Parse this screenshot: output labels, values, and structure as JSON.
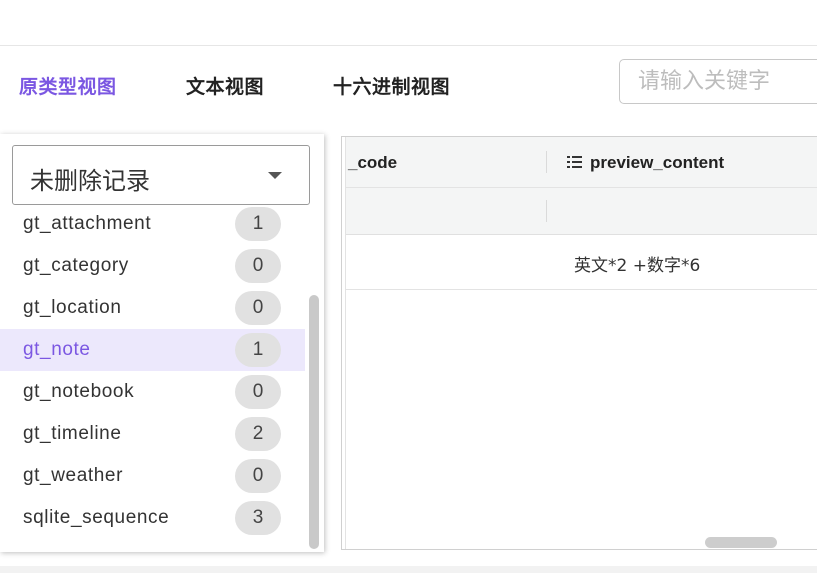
{
  "tabs": [
    {
      "label": "原类型视图",
      "active": true
    },
    {
      "label": "文本视图",
      "active": false
    },
    {
      "label": "十六进制视图",
      "active": false
    }
  ],
  "search": {
    "placeholder": "请输入关键字",
    "value": ""
  },
  "filter_select": {
    "selected": "未删除记录"
  },
  "tables": [
    {
      "name": "gt_attachment",
      "count": "1"
    },
    {
      "name": "gt_category",
      "count": "0"
    },
    {
      "name": "gt_location",
      "count": "0"
    },
    {
      "name": "gt_note",
      "count": "1",
      "selected": true
    },
    {
      "name": "gt_notebook",
      "count": "0"
    },
    {
      "name": "gt_timeline",
      "count": "2"
    },
    {
      "name": "gt_weather",
      "count": "0"
    },
    {
      "name": "sqlite_sequence",
      "count": "3"
    }
  ],
  "grid": {
    "columns": [
      {
        "label": "_code"
      },
      {
        "label": "preview_content"
      }
    ],
    "rows": [
      [
        "",
        "英文*2 +数字*6"
      ]
    ]
  },
  "colors": {
    "accent": "#7b57e2",
    "selected_row_bg": "#ece8fc",
    "badge_bg": "#e1e1e1"
  },
  "icons": {
    "dropdown": "caret-down-icon",
    "column_type": "list-icon"
  }
}
